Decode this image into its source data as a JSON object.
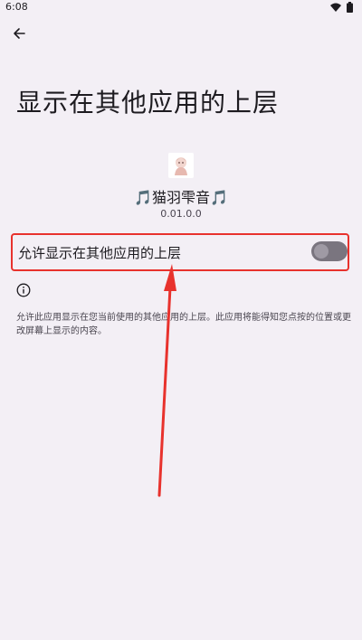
{
  "status_bar": {
    "time": "6:08",
    "icons": [
      "wifi-icon",
      "battery-icon"
    ]
  },
  "header": {
    "back_icon": "arrow-back-icon"
  },
  "page": {
    "title": "显示在其他应用的上层"
  },
  "app": {
    "icon": "app-icon",
    "name": "🎵猫羽雫音🎵",
    "version": "0.01.0.0"
  },
  "permission": {
    "toggle_label": "允许显示在其他应用的上层",
    "toggle_state": "off",
    "info_icon": "info-icon",
    "description": "允许此应用显示在您当前使用的其他应用的上层。此应用将能得知您点按的位置或更改屏幕上显示的内容。"
  },
  "colors": {
    "background": "#f3eff5",
    "highlight": "#e8322d",
    "switch_track": "#7a757f",
    "switch_thumb": "#9f9aa4"
  }
}
